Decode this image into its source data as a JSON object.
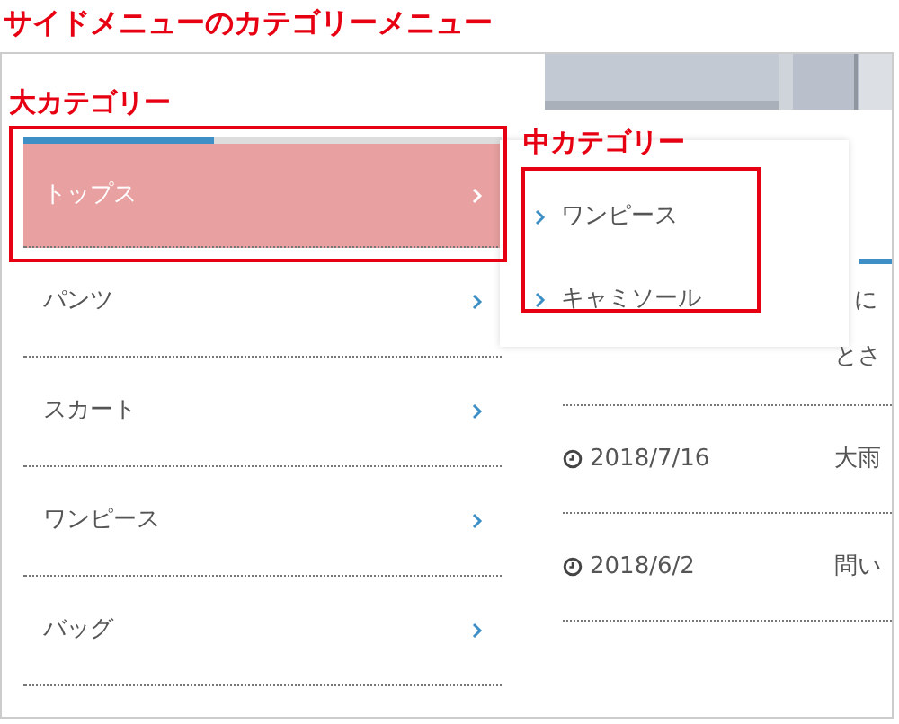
{
  "annotation_title": "サイドメニューのカテゴリーメニュー",
  "annotations": [
    {
      "label": "大カテゴリー"
    },
    {
      "label": "中カテゴリー"
    }
  ],
  "sidebar": {
    "progress": {
      "level": 0.4
    },
    "items": [
      {
        "label": "トップス",
        "selected": true
      },
      {
        "label": "パンツ",
        "selected": false
      },
      {
        "label": "スカート",
        "selected": false
      },
      {
        "label": "ワンピース",
        "selected": false
      },
      {
        "label": "バッグ",
        "selected": false
      }
    ]
  },
  "submenu": {
    "items": [
      {
        "label": "ワンピース"
      },
      {
        "label": "キャミソール"
      }
    ]
  },
  "news": {
    "fragments": [
      "に",
      "とさ"
    ],
    "rows": [
      {
        "date": "2018/7/16",
        "title": "大雨"
      },
      {
        "date": "2018/6/2",
        "title": "問い"
      }
    ]
  }
}
